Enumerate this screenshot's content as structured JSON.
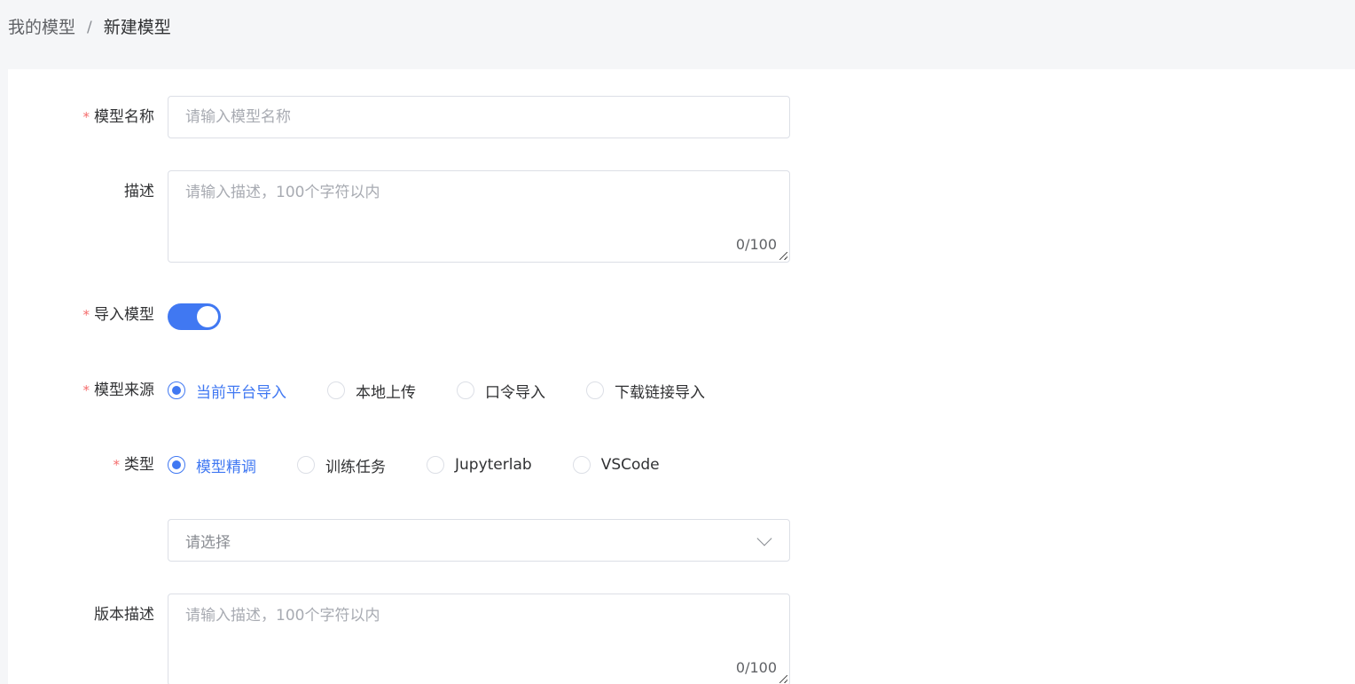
{
  "breadcrumb": {
    "parent": "我的模型",
    "separator": "/",
    "current": "新建模型"
  },
  "form": {
    "model_name": {
      "label": "模型名称",
      "required_mark": "*",
      "value": "",
      "placeholder": "请输入模型名称"
    },
    "description": {
      "label": "描述",
      "value": "",
      "placeholder": "请输入描述，100个字符以内",
      "counter": "0/100"
    },
    "import_model": {
      "label": "导入模型",
      "required_mark": "*",
      "enabled": true
    },
    "model_source": {
      "label": "模型来源",
      "required_mark": "*",
      "options": [
        "当前平台导入",
        "本地上传",
        "口令导入",
        "下载链接导入"
      ],
      "selected": "当前平台导入"
    },
    "type": {
      "label": "类型",
      "required_mark": "*",
      "options": [
        "模型精调",
        "训练任务",
        "Jupyterlab",
        "VSCode"
      ],
      "selected": "模型精调"
    },
    "task_select": {
      "placeholder": "请选择",
      "icon": "chevron-down-icon"
    },
    "version_description": {
      "label": "版本描述",
      "value": "",
      "placeholder": "请输入描述，100个字符以内",
      "counter": "0/100"
    }
  },
  "colors": {
    "accent": "#4078f2",
    "required": "#f56c6c",
    "page_background": "#f5f6f8",
    "panel_background": "#ffffff"
  }
}
